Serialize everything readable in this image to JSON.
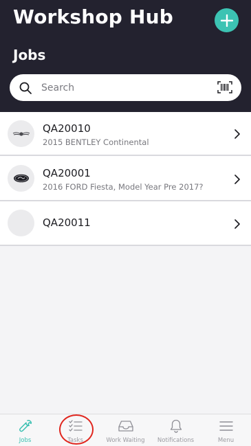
{
  "header": {
    "app_title": "Workshop Hub",
    "add_icon": "plus-icon",
    "section_title": "Jobs"
  },
  "search": {
    "placeholder": "Search",
    "value": "",
    "barcode_icon": "barcode-scan-icon"
  },
  "jobs": [
    {
      "code": "QA20010",
      "vehicle": "2015 BENTLEY Continental",
      "logo": "bentley-logo"
    },
    {
      "code": "QA20001",
      "vehicle": "2016 FORD Fiesta, Model Year Pre 2017?",
      "logo": "ford-logo"
    },
    {
      "code": "QA20011",
      "vehicle": "",
      "logo": ""
    }
  ],
  "tabbar": {
    "items": [
      {
        "label": "Jobs",
        "icon": "wrench-icon",
        "active": true
      },
      {
        "label": "Tasks",
        "icon": "checklist-icon",
        "active": false
      },
      {
        "label": "Work Waiting",
        "icon": "inbox-icon",
        "active": false
      },
      {
        "label": "Notifications",
        "icon": "bell-icon",
        "active": false
      },
      {
        "label": "Menu",
        "icon": "hamburger-icon",
        "active": false
      }
    ]
  },
  "colors": {
    "header_bg": "#23222f",
    "accent": "#3cc3b3",
    "annotation": "#e0261e"
  }
}
